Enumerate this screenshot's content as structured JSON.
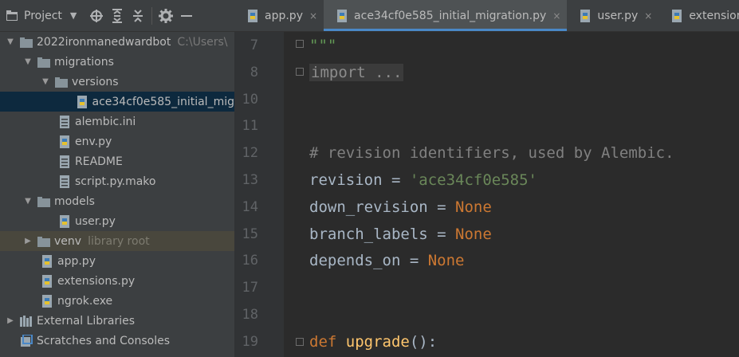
{
  "project_panel": {
    "title": "Project",
    "tree": [
      {
        "label": "2022ironmanedwardbot",
        "hint": "C:\\Users\\",
        "icon": "folder-icon",
        "expanded": true
      },
      {
        "label": "migrations",
        "icon": "folder-icon",
        "expanded": true
      },
      {
        "label": "versions",
        "icon": "folder-icon",
        "expanded": true
      },
      {
        "label": "ace34cf0e585_initial_mig",
        "icon": "python-file-icon",
        "selected": true
      },
      {
        "label": "alembic.ini",
        "icon": "file-icon"
      },
      {
        "label": "env.py",
        "icon": "python-file-icon"
      },
      {
        "label": "README",
        "icon": "file-icon"
      },
      {
        "label": "script.py.mako",
        "icon": "file-icon"
      },
      {
        "label": "models",
        "icon": "folder-icon",
        "expanded": true
      },
      {
        "label": "user.py",
        "icon": "python-file-icon"
      },
      {
        "label": "venv",
        "hint": "library root",
        "icon": "folder-icon",
        "expanded": false
      },
      {
        "label": "app.py",
        "icon": "python-file-icon"
      },
      {
        "label": "extensions.py",
        "icon": "python-file-icon"
      },
      {
        "label": "ngrok.exe",
        "icon": "python-file-icon"
      },
      {
        "label": "External Libraries",
        "icon": "library-icon",
        "expanded": false
      },
      {
        "label": "Scratches and Consoles",
        "icon": "scratches-icon"
      }
    ]
  },
  "tabs": [
    {
      "label": "app.py",
      "active": false,
      "icon": "python-file-icon"
    },
    {
      "label": "ace34cf0e585_initial_migration.py",
      "active": true,
      "icon": "python-file-icon"
    },
    {
      "label": "user.py",
      "active": false,
      "icon": "python-file-icon"
    },
    {
      "label": "extensions.",
      "active": false,
      "icon": "python-file-icon"
    }
  ],
  "tab_close_glyph": "×",
  "editor": {
    "line_numbers": [
      "7",
      "8",
      "10",
      "11",
      "12",
      "13",
      "14",
      "15",
      "16",
      "17",
      "18",
      "19"
    ],
    "code": {
      "l7": "\"\"\"",
      "l8": "import ...",
      "l12": "# revision identifiers, used by Alembic.",
      "l13_var": "revision = ",
      "l13_val": "'ace34cf0e585'",
      "l14_var": "down_revision = ",
      "l15_var": "branch_labels = ",
      "l16_var": "depends_on = ",
      "none_kw": "None",
      "l19_def": "def ",
      "l19_fn": "upgrade",
      "l19_rest": "():"
    }
  },
  "colors": {
    "keyword": "#cc7832",
    "function": "#ffc66d",
    "string": "#6a8759",
    "comment": "#808080",
    "selection": "#0d293e",
    "accent": "#4a88c7"
  }
}
